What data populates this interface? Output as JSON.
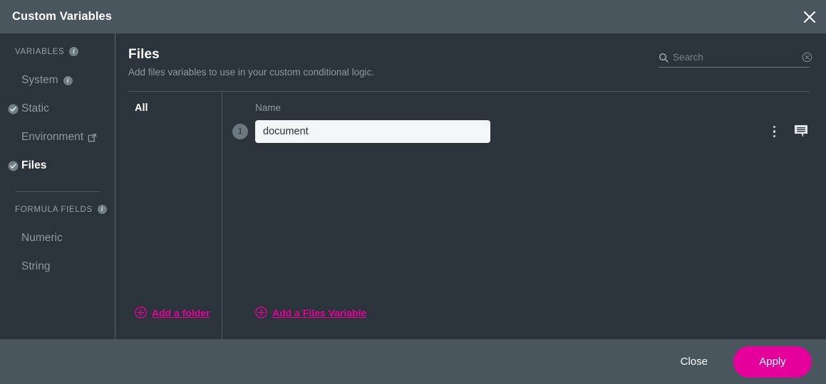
{
  "window": {
    "title": "Custom Variables",
    "close_icon": "close-icon"
  },
  "sidebar": {
    "sections": [
      {
        "label": "VARIABLES",
        "info_icon": "info-icon",
        "items": [
          {
            "label": "System",
            "state": "plain",
            "info_icon": "info-icon"
          },
          {
            "label": "Static",
            "state": "checked"
          },
          {
            "label": "Environment",
            "state": "plain",
            "external_icon": "external-link-icon"
          },
          {
            "label": "Files",
            "state": "checked-active"
          }
        ]
      },
      {
        "label": "FORMULA FIELDS",
        "info_icon": "info-icon",
        "items": [
          {
            "label": "Numeric",
            "state": "plain"
          },
          {
            "label": "String",
            "state": "plain"
          }
        ]
      }
    ]
  },
  "main": {
    "title": "Files",
    "subtitle": "Add files variables to use in your custom conditional logic.",
    "search": {
      "icon": "search-icon",
      "placeholder": "Search",
      "value": "",
      "clear_icon": "clear-circle-icon"
    },
    "folders": {
      "header": "All",
      "add_label": "Add a folder",
      "add_icon": "plus-circle-icon"
    },
    "variables": {
      "column_header": "Name",
      "rows": [
        {
          "index": "1",
          "name": "document",
          "menu_icon": "kebab-menu-icon",
          "comment_icon": "comment-icon"
        }
      ],
      "add_label": "Add a Files Variable",
      "add_icon": "plus-circle-icon"
    }
  },
  "footer": {
    "close_label": "Close",
    "apply_label": "Apply"
  },
  "colors": {
    "accent": "#e6009b",
    "titlebar": "#4a565d",
    "body": "#2b343b",
    "footer": "#49565d",
    "muted_text": "#8e99a1"
  }
}
